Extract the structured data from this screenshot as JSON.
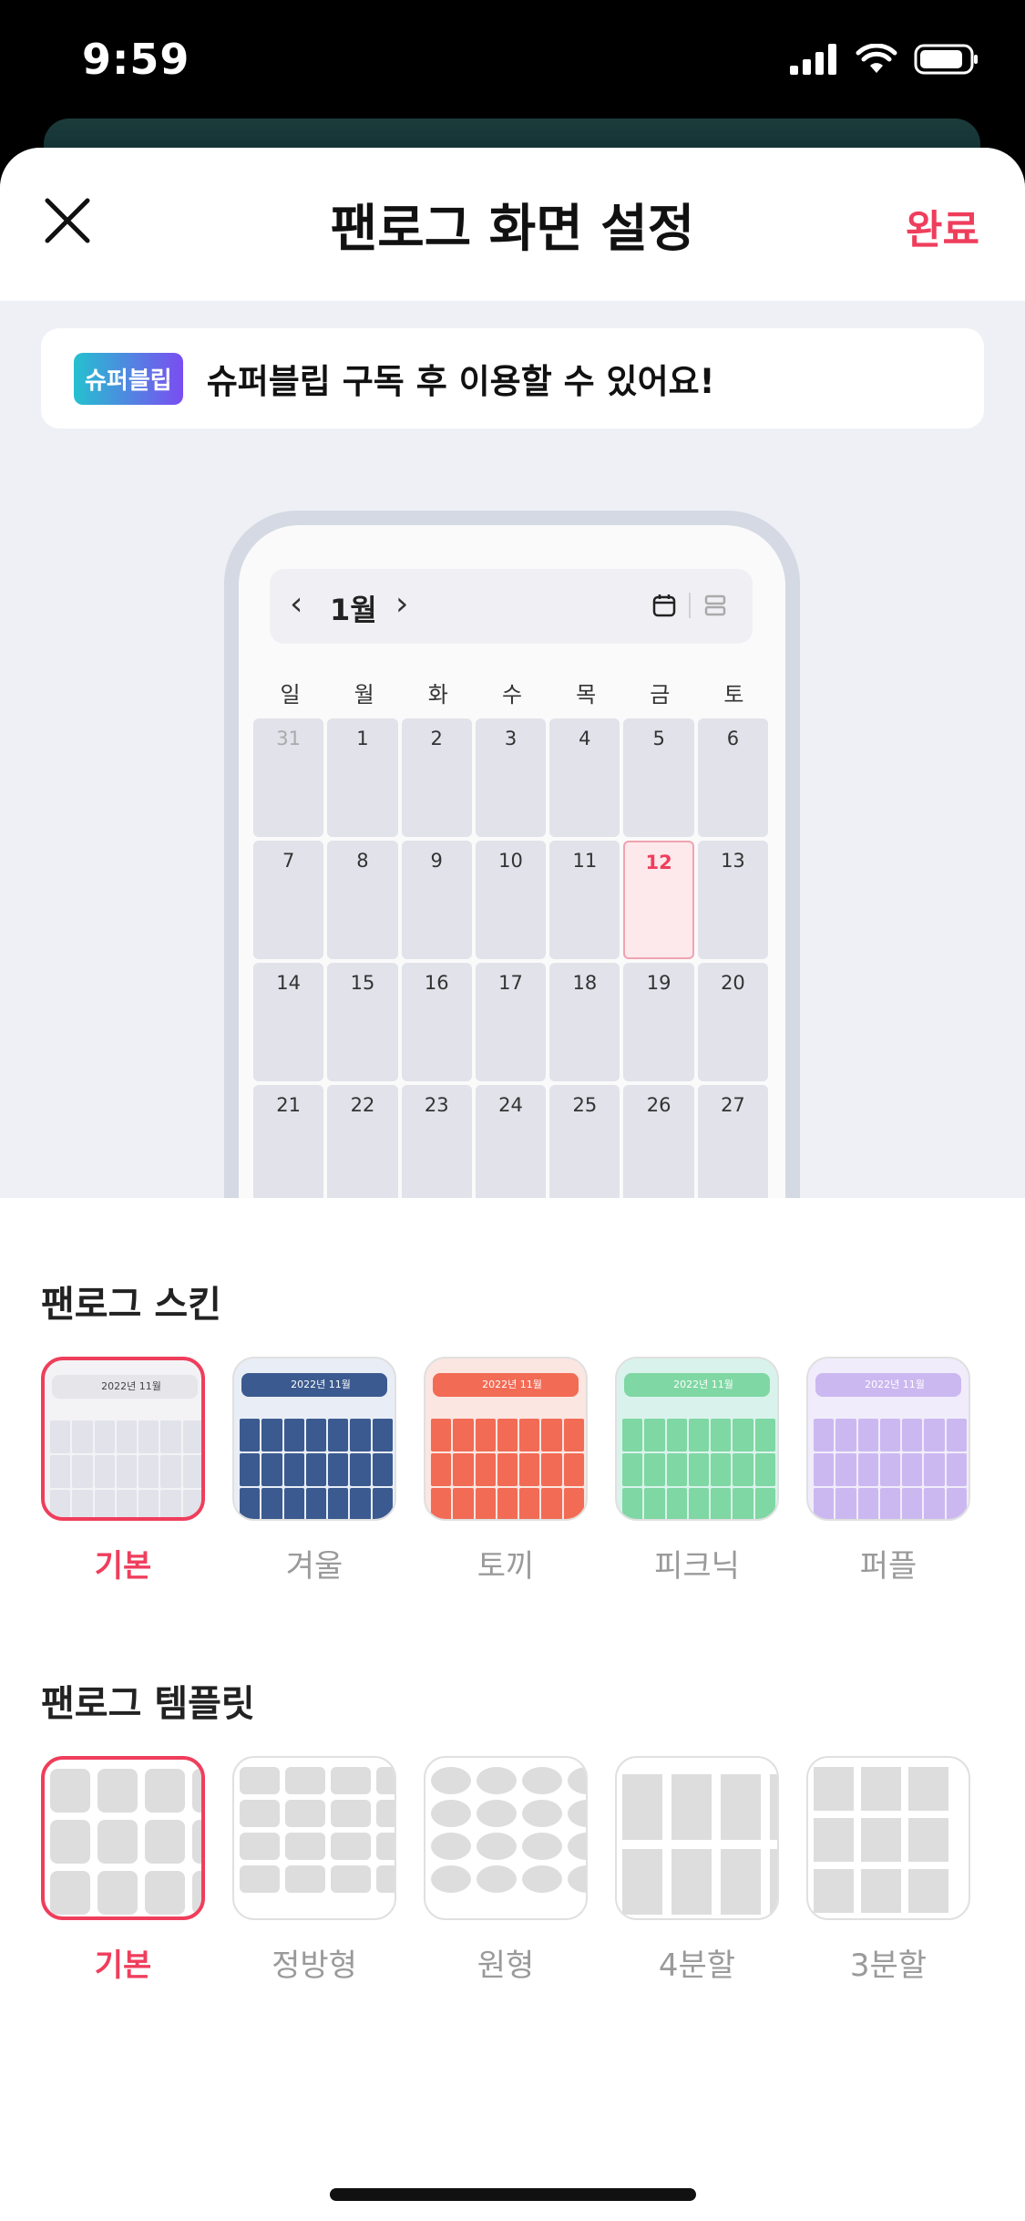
{
  "status_bar": {
    "time": "9:59"
  },
  "header": {
    "title": "팬로그 화면 설정",
    "done_label": "완료"
  },
  "banner": {
    "badge": "슈퍼블립",
    "text": "슈퍼블립 구독 후 이용할 수 있어요!"
  },
  "calendar": {
    "month": "1월",
    "weekdays": [
      "일",
      "월",
      "화",
      "수",
      "목",
      "금",
      "토"
    ],
    "days": [
      "31",
      "1",
      "2",
      "3",
      "4",
      "5",
      "6",
      "7",
      "8",
      "9",
      "10",
      "11",
      "12",
      "13",
      "14",
      "15",
      "16",
      "17",
      "18",
      "19",
      "20",
      "21",
      "22",
      "23",
      "24",
      "25",
      "26",
      "27"
    ],
    "today": "12"
  },
  "skins": {
    "title": "팬로그 스킨",
    "items": [
      {
        "label": "기본",
        "selected": true,
        "color": "#e1e2ea",
        "top": "#f3f3f6"
      },
      {
        "label": "겨울",
        "selected": false,
        "color": "#3b5a8f",
        "top": "#e9eef6"
      },
      {
        "label": "토끼",
        "selected": false,
        "color": "#f26b55",
        "top": "#fbe6e1"
      },
      {
        "label": "피크닉",
        "selected": false,
        "color": "#7fd7a3",
        "top": "#d9f3ec"
      },
      {
        "label": "퍼플",
        "selected": false,
        "color": "#cbb8f0",
        "top": "#f1ecfb"
      }
    ],
    "thumb_header_text": "2022년 11월"
  },
  "templates": {
    "title": "팬로그 템플릿",
    "items": [
      {
        "label": "기본",
        "selected": true
      },
      {
        "label": "정방형",
        "selected": false
      },
      {
        "label": "원형",
        "selected": false
      },
      {
        "label": "4분할",
        "selected": false
      },
      {
        "label": "3분할",
        "selected": false
      }
    ]
  },
  "colors": {
    "accent": "#ef3e5c",
    "preview_bg": "#eef0f5"
  }
}
